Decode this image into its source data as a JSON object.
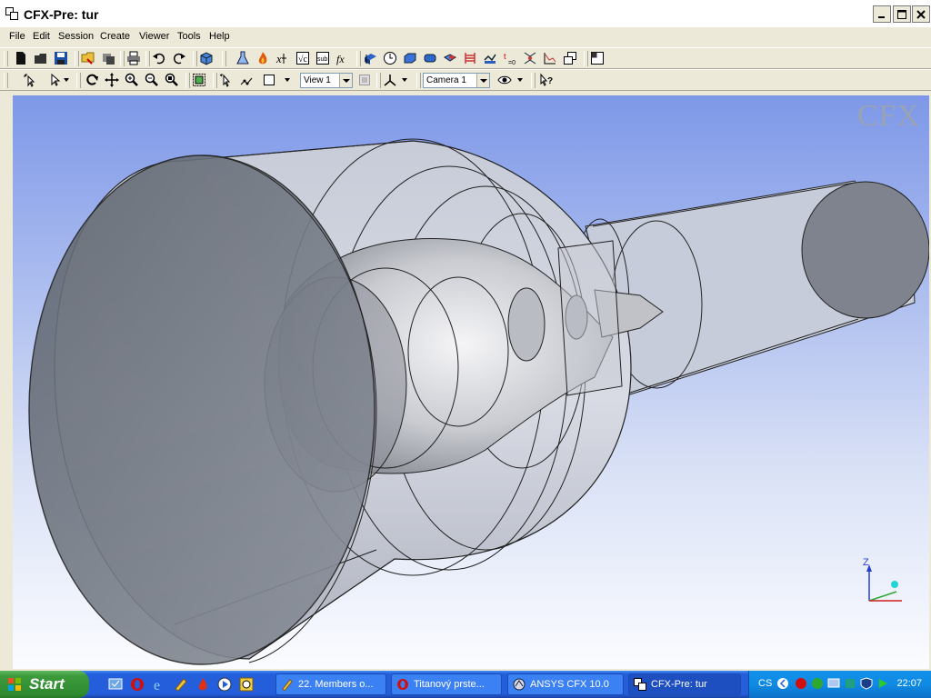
{
  "window": {
    "title": "CFX-Pre:  tur"
  },
  "menu": [
    "File",
    "Edit",
    "Session",
    "Create",
    "Viewer",
    "Tools",
    "Help"
  ],
  "toolbar2": {
    "view_combo": "View 1",
    "camera_combo": "Camera 1"
  },
  "viewer": {
    "logo_text": "CFX",
    "axis_label": "Z"
  },
  "taskbar": {
    "start_label": "Start",
    "tasks": [
      "22. Members o...",
      "Titanový prste...",
      "ANSYS CFX 10.0",
      "CFX-Pre:  tur"
    ],
    "tray_language": "CS",
    "clock": "22:07"
  }
}
